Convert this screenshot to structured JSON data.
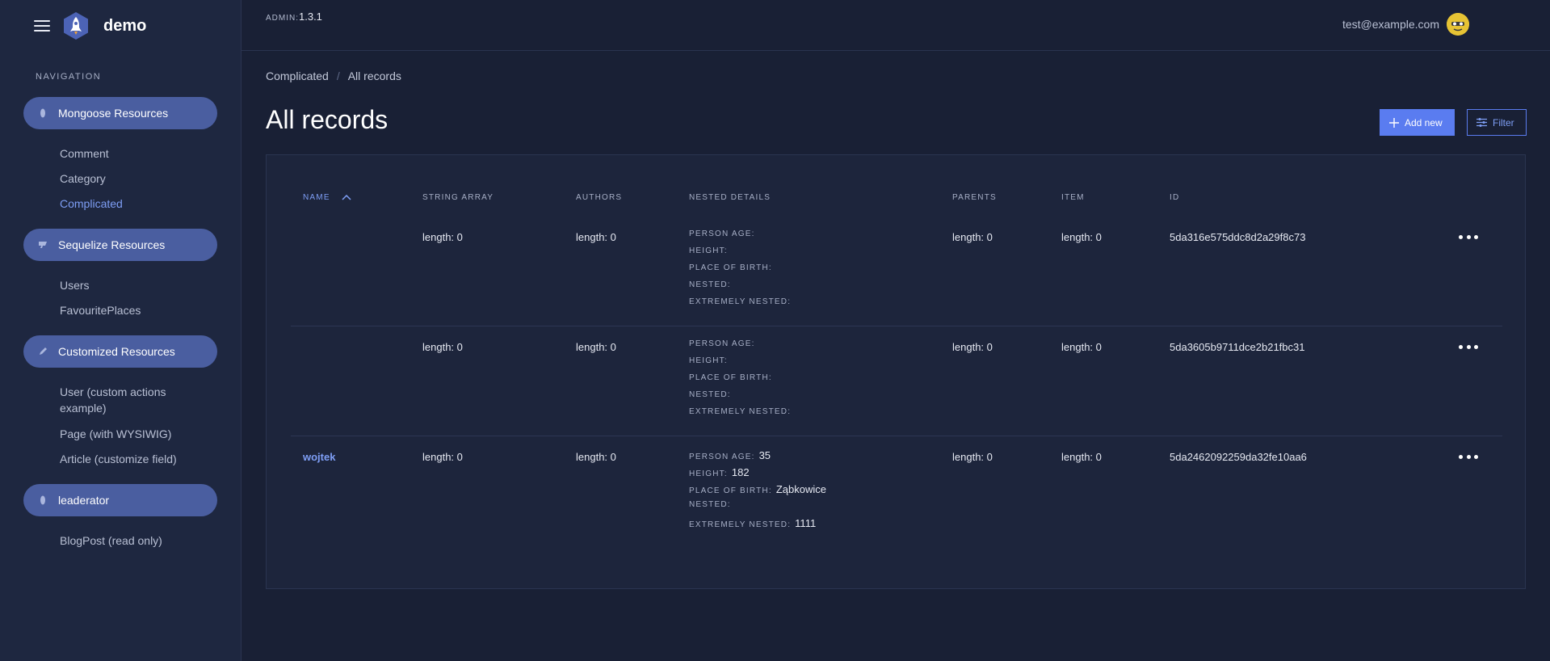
{
  "app": {
    "name": "demo"
  },
  "sidebar": {
    "heading": "NAVIGATION",
    "groups": [
      {
        "label": "Mongoose Resources",
        "icon": "leaf-icon",
        "items": [
          {
            "label": "Comment"
          },
          {
            "label": "Category"
          },
          {
            "label": "Complicated",
            "active": true
          }
        ]
      },
      {
        "label": "Sequelize Resources",
        "icon": "database-icon",
        "items": [
          {
            "label": "Users"
          },
          {
            "label": "FavouritePlaces"
          }
        ]
      },
      {
        "label": "Customized Resources",
        "icon": "pencil-icon",
        "items": [
          {
            "label": "User (custom actions"
          },
          {
            "label": "example)"
          },
          {
            "label": "Page (with WYSIWIG)"
          },
          {
            "label": "Article (customize field)"
          }
        ]
      },
      {
        "label": "leaderator",
        "icon": "leaf-icon",
        "items": [
          {
            "label": "BlogPost (read only)"
          }
        ]
      }
    ]
  },
  "topbar": {
    "version_label": "ADMIN:",
    "version": "1.3.1",
    "user_email": "test@example.com"
  },
  "breadcrumb": [
    "Complicated",
    "/",
    "All records"
  ],
  "page": {
    "title": "All records",
    "add_label": "Add new",
    "filter_label": "Filter"
  },
  "table": {
    "columns": [
      "NAME",
      "STRING ARRAY",
      "AUTHORS",
      "NESTED DETAILS",
      "PARENTS",
      "ITEM",
      "ID"
    ],
    "nested_labels": [
      "PERSON AGE:",
      "HEIGHT:",
      "PLACE OF BIRTH:",
      "NESTED:",
      "EXTREMELY NESTED:"
    ],
    "rows": [
      {
        "name": "",
        "string_array": "length: 0",
        "authors": "length: 0",
        "nested": [
          "",
          "",
          "",
          "",
          ""
        ],
        "parents": "length: 0",
        "item": "length: 0",
        "id": "5da316e575ddc8d2a29f8c73"
      },
      {
        "name": "",
        "string_array": "length: 0",
        "authors": "length: 0",
        "nested": [
          "",
          "",
          "",
          "",
          ""
        ],
        "parents": "length: 0",
        "item": "length: 0",
        "id": "5da3605b9711dce2b21fbc31"
      },
      {
        "name": "wojtek",
        "string_array": "length: 0",
        "authors": "length: 0",
        "nested": [
          "35",
          "182",
          "Ząbkowice",
          "",
          "1111"
        ],
        "parents": "length: 0",
        "item": "length: 0",
        "id": "5da2462092259da32fe10aa6"
      }
    ]
  },
  "colors": {
    "background": "#192035",
    "sidebar": "#1e2740",
    "accent": "#5a7cf0",
    "nav_pill": "#4a5ea0"
  }
}
